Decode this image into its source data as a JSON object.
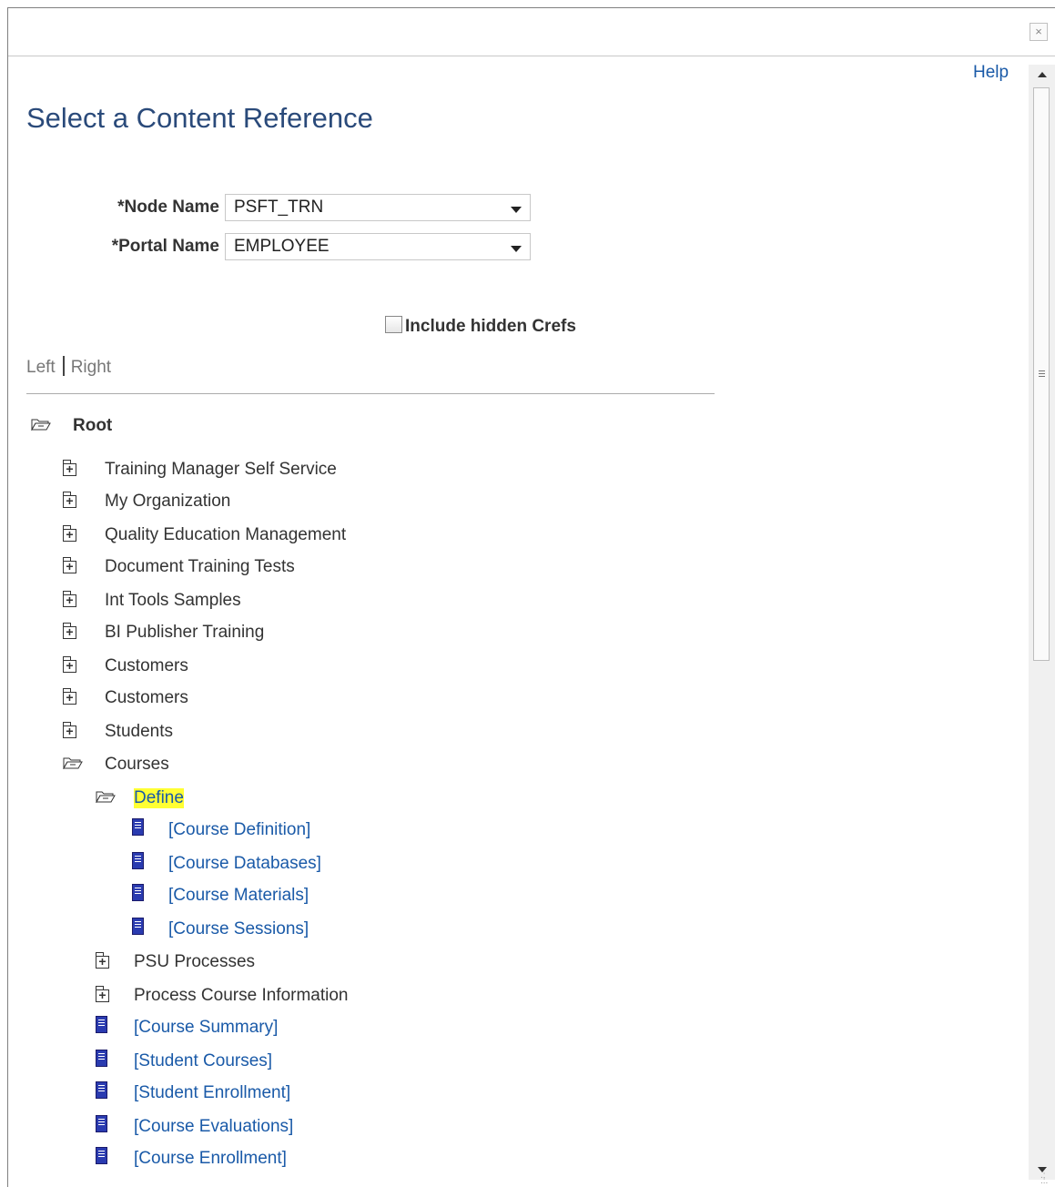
{
  "dialog": {
    "close_glyph": "×"
  },
  "help_label": "Help",
  "page_title": "Select a Content Reference",
  "form": {
    "node_name_label": "*Node Name",
    "node_name_value": "PSFT_TRN",
    "portal_name_label": "*Portal Name",
    "portal_name_value": "EMPLOYEE",
    "include_hidden_label": "Include hidden Crefs",
    "include_hidden_checked": false
  },
  "view_toggle": {
    "left": "Left",
    "right": "Right"
  },
  "tree": {
    "root": "Root",
    "nodes": [
      {
        "label": "Training Manager Self Service",
        "icon": "folder-closed-icon"
      },
      {
        "label": "My Organization",
        "icon": "folder-closed-icon"
      },
      {
        "label": "Quality Education Management",
        "icon": "folder-closed-icon"
      },
      {
        "label": "Document Training Tests",
        "icon": "folder-closed-icon"
      },
      {
        "label": "Int Tools Samples",
        "icon": "folder-closed-icon"
      },
      {
        "label": "BI Publisher Training",
        "icon": "folder-closed-icon"
      },
      {
        "label": "Customers",
        "icon": "folder-closed-icon"
      },
      {
        "label": "Customers",
        "icon": "folder-closed-icon"
      },
      {
        "label": "Students",
        "icon": "folder-closed-icon"
      },
      {
        "label": "Courses",
        "icon": "folder-open-icon"
      },
      {
        "label": "Define",
        "icon": "folder-open-icon",
        "highlighted": true
      },
      {
        "label": "[Course Definition]",
        "icon": "document-icon"
      },
      {
        "label": "[Course Databases]",
        "icon": "document-icon"
      },
      {
        "label": "[Course Materials]",
        "icon": "document-icon"
      },
      {
        "label": "[Course Sessions]",
        "icon": "document-icon"
      },
      {
        "label": "PSU Processes",
        "icon": "folder-closed-icon"
      },
      {
        "label": "Process Course Information",
        "icon": "folder-closed-icon"
      },
      {
        "label": "[Course Summary]",
        "icon": "document-icon"
      },
      {
        "label": "[Student Courses]",
        "icon": "document-icon"
      },
      {
        "label": "[Student Enrollment]",
        "icon": "document-icon"
      },
      {
        "label": "[Course Evaluations]",
        "icon": "document-icon"
      },
      {
        "label": "[Course Enrollment]",
        "icon": "document-icon"
      }
    ]
  },
  "colors": {
    "link": "#1a5aa8",
    "title": "#2a4a7a",
    "highlight": "#ffff33"
  }
}
